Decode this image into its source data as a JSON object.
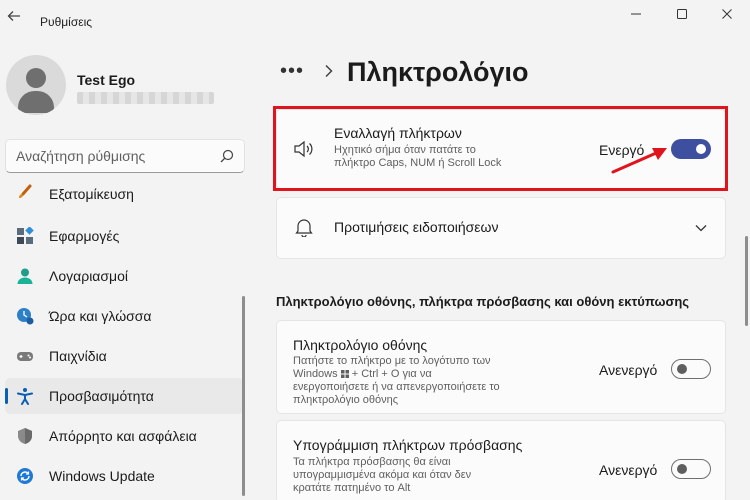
{
  "app": {
    "title": "Ρυθμίσεις"
  },
  "profile": {
    "name": "Test Ego"
  },
  "search": {
    "placeholder": "Αναζήτηση ρύθμισης"
  },
  "sidebar": {
    "items": [
      {
        "label": "Εξατομίκευση",
        "icon": "brush-icon",
        "active": false
      },
      {
        "label": "Εφαρμογές",
        "icon": "apps-icon",
        "active": false
      },
      {
        "label": "Λογαριασμοί",
        "icon": "account-icon",
        "active": false
      },
      {
        "label": "Ώρα και γλώσσα",
        "icon": "time-language-icon",
        "active": false
      },
      {
        "label": "Παιχνίδια",
        "icon": "gamepad-icon",
        "active": false
      },
      {
        "label": "Προσβασιμότητα",
        "icon": "accessibility-icon",
        "active": true
      },
      {
        "label": "Απόρρητο και ασφάλεια",
        "icon": "shield-icon",
        "active": false
      },
      {
        "label": "Windows Update",
        "icon": "update-icon",
        "active": false
      }
    ]
  },
  "header": {
    "dots": "•••",
    "title": "Πληκτρολόγιο"
  },
  "toggle_keys": {
    "title": "Εναλλαγή πλήκτρων",
    "desc_line1": "Ηχητικό σήμα όταν πατάτε το",
    "desc_line2": "πλήκτρο Caps, NUM ή Scroll Lock",
    "state": "Ενεργό",
    "on": true
  },
  "notifications": {
    "title": "Προτιμήσεις ειδοποιήσεων"
  },
  "section": {
    "heading": "Πληκτρολόγιο οθόνης, πλήκτρα πρόσβασης και οθόνη εκτύπωσης"
  },
  "onscreen_keyboard": {
    "title": "Πληκτρολόγιο οθόνης",
    "desc_line1": "Πατήστε το πλήκτρο με το λογότυπο των",
    "desc_line2_pre": "Windows",
    "desc_line2_post": "+ Ctrl + O για να",
    "desc_line3": "ενεργοποιήσετε ή να απενεργοποιήσετε το",
    "desc_line4": "πληκτρολόγιο οθόνης",
    "state": "Ανενεργό",
    "on": false
  },
  "access_keys": {
    "title": "Υπογράμμιση πλήκτρων πρόσβασης",
    "desc_line1": "Τα πλήκτρα πρόσβασης θα είναι",
    "desc_line2": "υπογραμμισμένα ακόμα και όταν δεν",
    "desc_line3": "κρατάτε πατημένο το Alt",
    "state": "Ανενεργό",
    "on": false
  },
  "colors": {
    "accent": "#3f4fa0",
    "highlight": "#e0141c",
    "active_bar": "#0a5eb5"
  }
}
